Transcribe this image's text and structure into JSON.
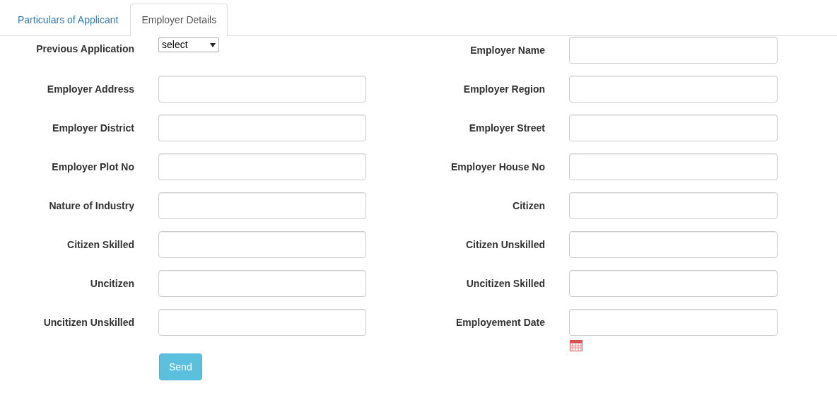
{
  "tabs": [
    {
      "label": "Particulars of Applicant",
      "selected": false
    },
    {
      "label": "Employer Details",
      "selected": true
    }
  ],
  "form": {
    "rows": [
      [
        {
          "kind": "select",
          "label": "Previous Application",
          "value": "select"
        },
        {
          "kind": "text",
          "label": "Employer Name"
        }
      ],
      [
        {
          "kind": "text",
          "label": "Employer Address"
        },
        {
          "kind": "text",
          "label": "Employer Region"
        }
      ],
      [
        {
          "kind": "text",
          "label": "Employer District"
        },
        {
          "kind": "text",
          "label": "Employer Street"
        }
      ],
      [
        {
          "kind": "text",
          "label": "Employer Plot No"
        },
        {
          "kind": "text",
          "label": "Employer House No"
        }
      ],
      [
        {
          "kind": "text",
          "label": "Nature of Industry"
        },
        {
          "kind": "text",
          "label": "Citizen"
        }
      ],
      [
        {
          "kind": "text",
          "label": "Citizen Skilled"
        },
        {
          "kind": "text",
          "label": "Citizen Unskilled"
        }
      ],
      [
        {
          "kind": "text",
          "label": "Uncitizen"
        },
        {
          "kind": "text",
          "label": "Uncitizen Skilled"
        }
      ],
      [
        {
          "kind": "text",
          "label": "Uncitizen Unskilled"
        },
        {
          "kind": "date",
          "label": "Employement Date"
        }
      ]
    ],
    "send_button": "Send"
  }
}
